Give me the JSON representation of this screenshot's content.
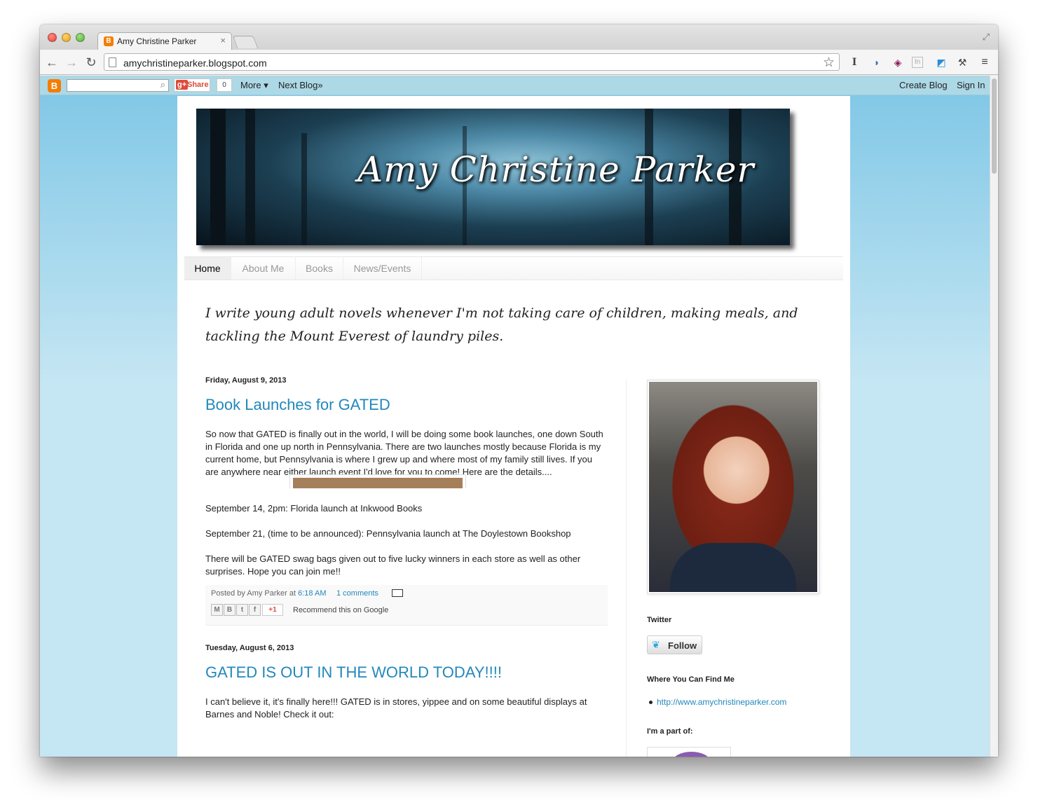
{
  "browser": {
    "tab_title": "Amy Christine Parker",
    "tab_close": "×",
    "url": "amychristineparker.blogspot.com"
  },
  "bloggerbar": {
    "share_label": "Share",
    "share_count": "0",
    "more_label": "More ▾",
    "next_blog_label": "Next Blog»",
    "create_blog_label": "Create Blog",
    "sign_in_label": "Sign In"
  },
  "blog": {
    "title": "Amy Christine Parker",
    "nav": [
      "Home",
      "About Me",
      "Books",
      "News/Events"
    ],
    "tagline": "I write young adult novels whenever I'm not taking care of children, making meals, and tackling the Mount Everest of laundry piles."
  },
  "posts": [
    {
      "date": "Friday, August 9, 2013",
      "title": "Book Launches for GATED",
      "paragraphs": [
        "So now that GATED is finally out in the world, I will be doing some book launches, one down South in Florida and one up north in Pennsylvania. There are two launches mostly because Florida is my current home, but Pennsylvania is where I grew up and where most of my family still lives. If you are anywhere near either launch event I'd love for you to come! Here are the details....",
        "September 14, 2pm: Florida launch at Inkwood Books",
        "September 21, (time to be announced): Pennsylvania launch at The Doylestown Bookshop",
        "There will be GATED swag bags given out to five lucky winners in each store as well as other surprises. Hope you can join me!!"
      ],
      "posted_by": "Posted by Amy Parker at",
      "time": "6:18 AM",
      "comments": "1 comments",
      "plus_one": "+1",
      "recommend": "Recommend this on Google"
    },
    {
      "date": "Tuesday, August 6, 2013",
      "title": "GATED IS OUT IN THE WORLD TODAY!!!!",
      "paragraphs": [
        "I can't believe it, it's finally here!!! GATED is in stores, yippee and on some beautiful displays at Barnes and Noble! Check it out:"
      ]
    }
  ],
  "sidebar": {
    "twitter_title": "Twitter",
    "follow_label": "Follow",
    "find_me_title": "Where You Can Find Me",
    "find_me_link": "http://www.amychristineparker.com",
    "part_of_title": "I'm a part of:"
  },
  "colors": {
    "link": "#2288bb",
    "page_bg_top": "#7ec6e6",
    "page_bg_bottom": "#c5e6f3",
    "blogger_orange": "#f57d00"
  }
}
